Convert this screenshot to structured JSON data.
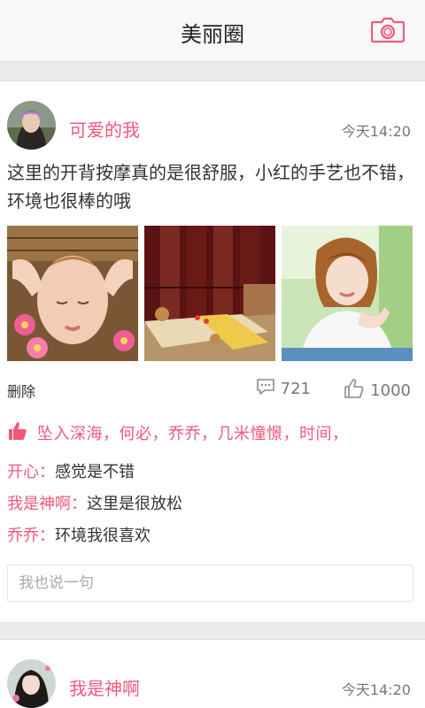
{
  "header": {
    "title": "美丽圈",
    "camera_icon": "camera-icon"
  },
  "accent_color": "#f0597a",
  "posts": [
    {
      "username": "可爱的我",
      "time": "今天14:20",
      "text": "这里的开背按摩真的是很舒服，小红的手艺也不错，环境也很棒的哦",
      "images": [
        "facial-massage-photo",
        "spa-room-photo",
        "smiling-woman-photo"
      ],
      "delete_label": "删除",
      "comment_count": "721",
      "like_count": "1000",
      "likers": "坠入深海，何必，乔乔，几米憧憬，时间，",
      "comments": [
        {
          "name": "开心",
          "sep": "：",
          "text": "感觉是不错"
        },
        {
          "name": "我是神啊",
          "sep": "：",
          "text": "这里是很放松"
        },
        {
          "name": "乔乔",
          "sep": "：",
          "text": "环境我很喜欢"
        }
      ],
      "reply_placeholder": "我也说一句"
    },
    {
      "username": "我是神啊",
      "time": "今天14:20"
    }
  ]
}
